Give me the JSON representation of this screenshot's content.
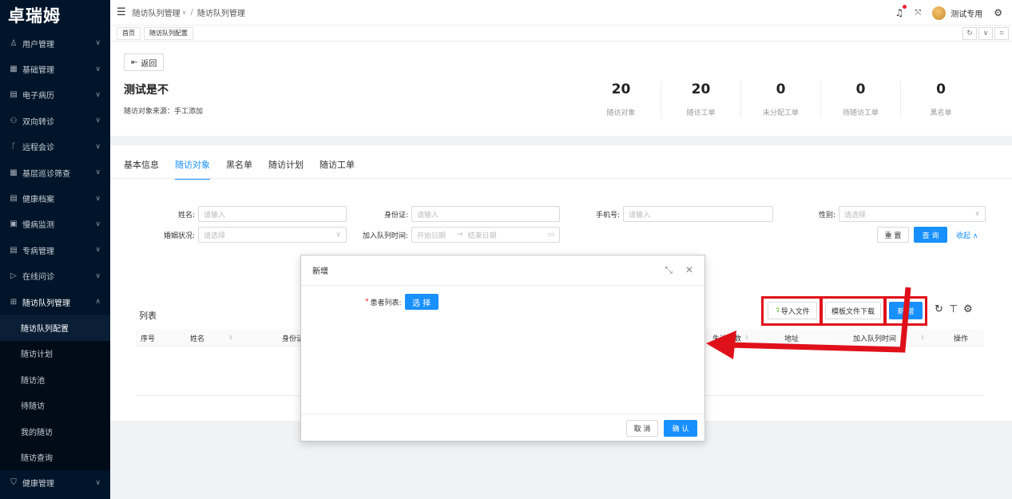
{
  "app": {
    "logo": "卓瑞姆"
  },
  "sidebar": {
    "items": [
      {
        "icon": "user-icon",
        "glyph": "♙",
        "label": "用户管理"
      },
      {
        "icon": "grid-icon",
        "glyph": "▦",
        "label": "基础管理"
      },
      {
        "icon": "record-icon",
        "glyph": "▤",
        "label": "电子病历"
      },
      {
        "icon": "people-icon",
        "glyph": "⚇",
        "label": "双向转诊"
      },
      {
        "icon": "branch-icon",
        "glyph": "ᚴ",
        "label": "远程会诊"
      },
      {
        "icon": "grid-icon",
        "glyph": "▦",
        "label": "基层巡诊筛查"
      },
      {
        "icon": "file-icon",
        "glyph": "▤",
        "label": "健康档案"
      },
      {
        "icon": "monitor-icon",
        "glyph": "▣",
        "label": "慢病监测"
      },
      {
        "icon": "file-icon",
        "glyph": "▤",
        "label": "专病管理"
      },
      {
        "icon": "play-icon",
        "glyph": "▷",
        "label": "在线问诊"
      },
      {
        "icon": "queue-icon",
        "glyph": "⊞",
        "label": "随访队列管理"
      }
    ],
    "sub_items": [
      "随访队列配置",
      "随访计划",
      "随访池",
      "待随访",
      "我的随访",
      "随访查询"
    ],
    "last_item": {
      "icon": "shield-icon",
      "glyph": "⛉",
      "label": "健康管理"
    }
  },
  "header": {
    "breadcrumb": [
      "随访队列管理",
      "随访队列管理"
    ],
    "username": "测试专用"
  },
  "page_tabs": [
    "首页",
    "随访队列配置"
  ],
  "queue": {
    "back_label": "返回",
    "title": "测试是不",
    "source_label": "随访对象来源：",
    "source_value": "手工添加",
    "stats": [
      {
        "value": "20",
        "label": "随访对象"
      },
      {
        "value": "20",
        "label": "随访工单"
      },
      {
        "value": "0",
        "label": "未分配工单"
      },
      {
        "value": "0",
        "label": "待随访工单"
      },
      {
        "value": "0",
        "label": "黑名单"
      }
    ]
  },
  "inner_tabs": [
    "基本信息",
    "随访对象",
    "黑名单",
    "随访计划",
    "随访工单"
  ],
  "filters": {
    "name_label": "姓名:",
    "name_placeholder": "请输入",
    "idcard_label": "身份证:",
    "idcard_placeholder": "请输入",
    "phone_label": "手机号:",
    "phone_placeholder": "请输入",
    "gender_label": "性别:",
    "gender_placeholder": "请选择",
    "marital_label": "婚姻状况:",
    "marital_placeholder": "请选择",
    "join_label": "加入队列时间:",
    "start_placeholder": "开始日期",
    "end_placeholder": "结束日期",
    "reset": "重 置",
    "search": "查 询",
    "collapse": "收起"
  },
  "list": {
    "title": "列表",
    "import": "导入文件",
    "template": "模板文件下载",
    "add": "新 增",
    "columns": [
      "序号",
      "姓名",
      "身份证",
      "失访次数",
      "地址",
      "加入队列时间",
      "操作"
    ]
  },
  "modal": {
    "title": "新增",
    "field_label": "患者列表:",
    "select_btn": "选 择",
    "cancel": "取 消",
    "ok": "确 认"
  },
  "colors": {
    "primary": "#1890ff",
    "sidebar": "#001529",
    "highlight": "#e0101a"
  }
}
